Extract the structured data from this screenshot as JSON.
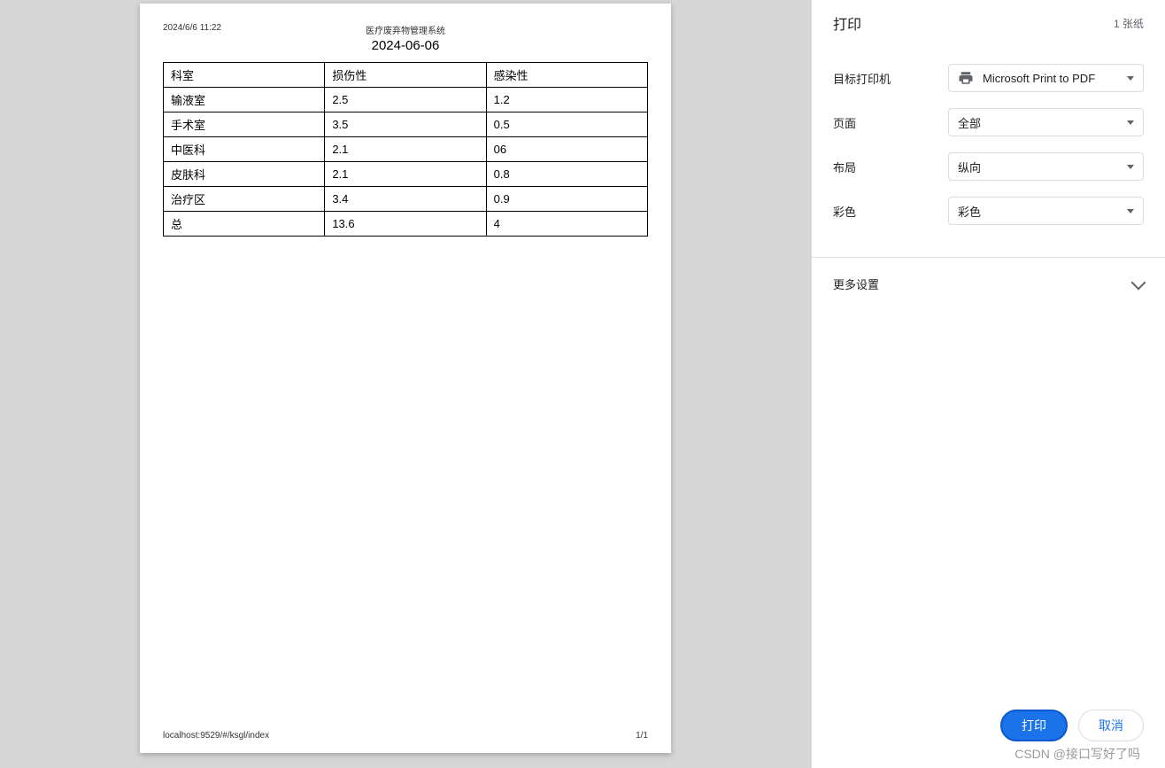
{
  "preview": {
    "timestamp": "2024/6/6 11:22",
    "header_title": "医疗废弃物管理系统",
    "page_title": "2024-06-06",
    "footer_url": "localhost:9529/#/ksgl/index",
    "footer_page": "1/1"
  },
  "table": {
    "headers": [
      "科室",
      "损伤性",
      "感染性"
    ],
    "rows": [
      [
        "输液室",
        "2.5",
        "1.2"
      ],
      [
        "手术室",
        "3.5",
        "0.5"
      ],
      [
        "中医科",
        "2.1",
        "06"
      ],
      [
        "皮肤科",
        "2.1",
        "0.8"
      ],
      [
        "治疗区",
        "3.4",
        "0.9"
      ],
      [
        "总",
        "13.6",
        "4"
      ]
    ]
  },
  "panel": {
    "title": "打印",
    "sheet_count": "1 张纸",
    "labels": {
      "destination": "目标打印机",
      "pages": "页面",
      "layout": "布局",
      "color": "彩色",
      "more": "更多设置"
    },
    "values": {
      "destination": "Microsoft Print to PDF",
      "pages": "全部",
      "layout": "纵向",
      "color": "彩色"
    },
    "buttons": {
      "print": "打印",
      "cancel": "取消"
    }
  },
  "watermark": "CSDN @接口写好了吗"
}
